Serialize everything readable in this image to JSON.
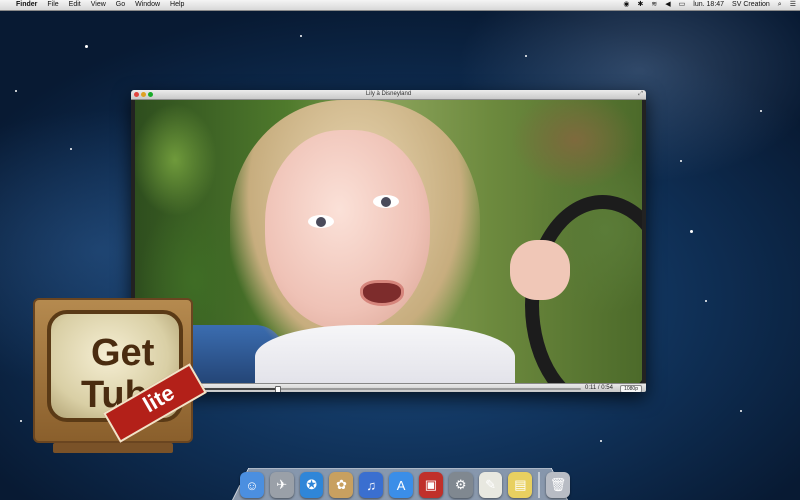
{
  "menubar": {
    "apple": "",
    "menus": [
      "Finder",
      "File",
      "Edit",
      "View",
      "Go",
      "Window",
      "Help"
    ],
    "status": {
      "clock": "lun. 18:47",
      "user": "SV Creation"
    }
  },
  "player": {
    "title": "Lily à Disneyland",
    "time_display": "0:11 / 0:54",
    "progress_fraction": 0.2,
    "quality": "1080p"
  },
  "desktop_app": {
    "word1": "Get",
    "word2": "Tube",
    "badge": "lite"
  },
  "dock": {
    "items": [
      {
        "icon": "finder-icon",
        "color": "#4b8fe0",
        "glyph": "☺"
      },
      {
        "icon": "launchpad-icon",
        "color": "#9aa0a8",
        "glyph": "✈"
      },
      {
        "icon": "safari-icon",
        "color": "#2f86d8",
        "glyph": "✪"
      },
      {
        "icon": "photos-icon",
        "color": "#c8a060",
        "glyph": "✿"
      },
      {
        "icon": "itunes-icon",
        "color": "#3a6fd0",
        "glyph": "♫"
      },
      {
        "icon": "app-store-icon",
        "color": "#3b8ee8",
        "glyph": "A"
      },
      {
        "icon": "photo-booth-icon",
        "color": "#c0302a",
        "glyph": "▣"
      },
      {
        "icon": "system-preferences-icon",
        "color": "#808890",
        "glyph": "⚙"
      },
      {
        "icon": "textedit-icon",
        "color": "#e8e8e0",
        "glyph": "✎"
      },
      {
        "icon": "stickies-icon",
        "color": "#e8d060",
        "glyph": "▤"
      },
      {
        "icon": "trash-icon",
        "color": "#b8bcc4",
        "glyph": "🗑"
      }
    ]
  }
}
